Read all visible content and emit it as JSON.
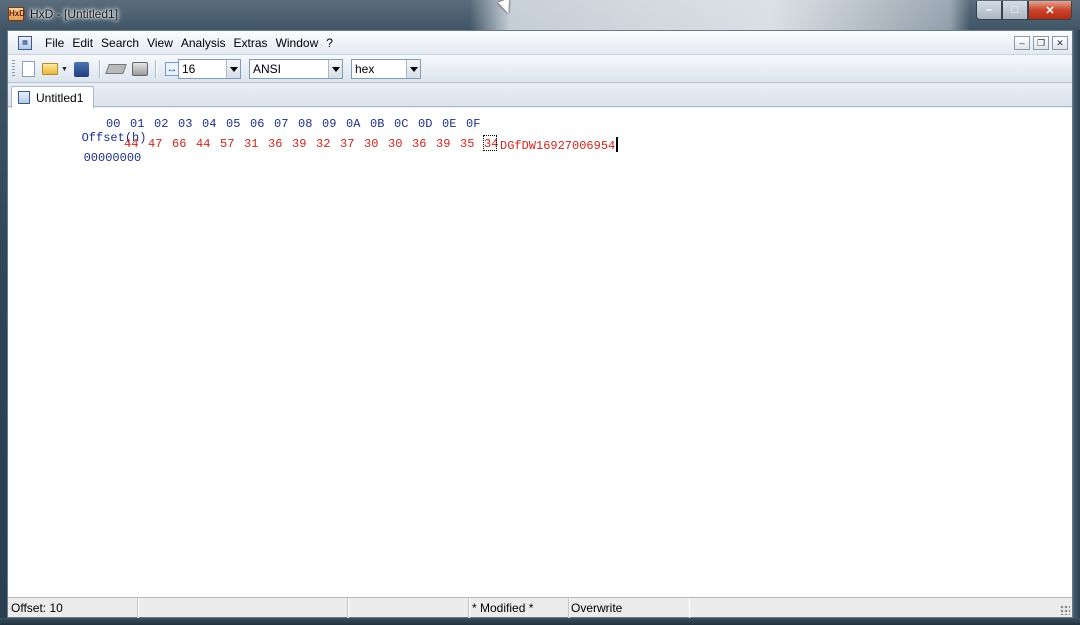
{
  "window": {
    "title": "HxD - [Untitled1]",
    "app_icon_text": "HxD",
    "controls": {
      "minimize": "–",
      "maximize": "□",
      "close": "✕"
    }
  },
  "menu": {
    "items": [
      "File",
      "Edit",
      "Search",
      "View",
      "Analysis",
      "Extras",
      "Window",
      "?"
    ]
  },
  "mdi_controls": {
    "minimize": "–",
    "restore": "❐",
    "close": "✕"
  },
  "toolbar": {
    "bytes_per_row": "16",
    "charset": "ANSI",
    "offset_base": "hex",
    "icons": [
      "new-file-icon",
      "open-file-icon",
      "save-icon",
      "open-ram-icon",
      "open-disk-icon",
      "bytes-per-row-icon"
    ]
  },
  "tabs": [
    {
      "label": "Untitled1"
    }
  ],
  "editor": {
    "offset_header": "Offset(h)",
    "column_headers": [
      "00",
      "01",
      "02",
      "03",
      "04",
      "05",
      "06",
      "07",
      "08",
      "09",
      "0A",
      "0B",
      "0C",
      "0D",
      "0E",
      "0F"
    ],
    "rows": [
      {
        "offset": "00000000",
        "bytes": [
          "44",
          "47",
          "66",
          "44",
          "57",
          "31",
          "36",
          "39",
          "32",
          "37",
          "30",
          "30",
          "36",
          "39",
          "35",
          "34"
        ],
        "ascii": "DGfDW16927006954"
      }
    ]
  },
  "status": {
    "offset": "Offset: 10",
    "modified": "* Modified *",
    "mode": "Overwrite"
  },
  "colors": {
    "offset_blue": "#1a2f8a",
    "data_red": "#d2241a"
  }
}
